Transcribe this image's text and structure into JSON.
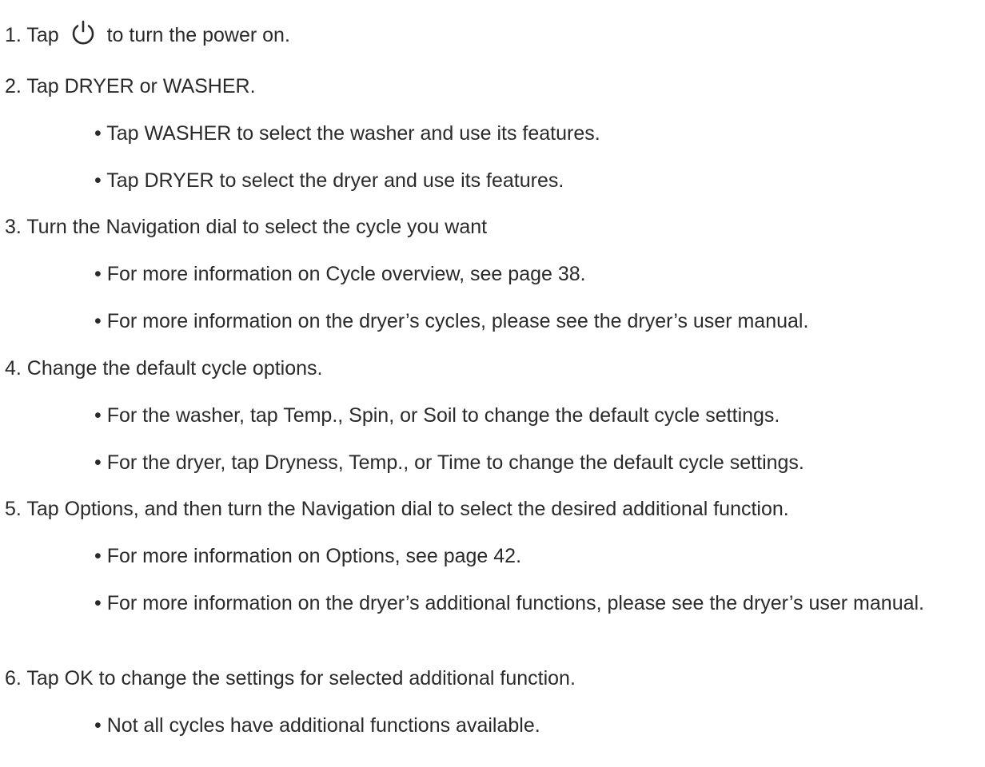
{
  "steps": [
    {
      "num": "1.",
      "pre": "Tap",
      "icon": "power-icon",
      "post": "to turn the power on."
    },
    {
      "text": "2. Tap DRYER or WASHER.",
      "bullets": [
        "• Tap WASHER to select the washer and use its features.",
        "• Tap DRYER to select the dryer and use its features."
      ]
    },
    {
      "text": "3. Turn the Navigation dial to select the cycle you want",
      "bullets": [
        "• For more information on Cycle overview, see page 38.",
        "• For more information on the dryer’s cycles, please see the dryer’s user manual."
      ]
    },
    {
      "text": "4. Change the default cycle options.",
      "bullets": [
        "• For the washer, tap Temp., Spin, or Soil to change the default cycle settings.",
        "• For the dryer, tap Dryness, Temp., or Time to change the default cycle settings."
      ]
    },
    {
      "text": "5. Tap Options, and then turn the Navigation dial to select the desired additional function.",
      "bullets": [
        "• For more information on Options, see page 42.",
        "• For more information on the dryer’s additional functions, please see the dryer’s user manual."
      ]
    },
    {
      "text": "6. Tap OK to change the settings for selected additional function.",
      "bullets": [
        "• Not all cycles have additional functions available."
      ]
    }
  ]
}
